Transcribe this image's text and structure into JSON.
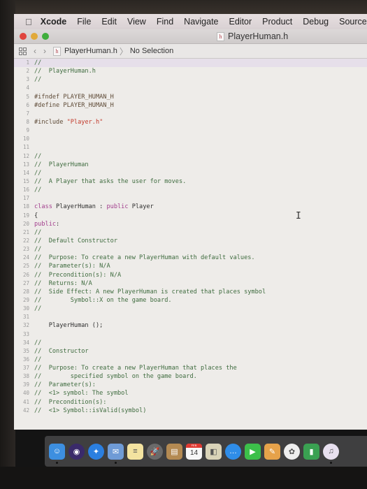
{
  "menubar": {
    "apple_icon": "apple-icon",
    "items": [
      "Xcode",
      "File",
      "Edit",
      "View",
      "Find",
      "Navigate",
      "Editor",
      "Product",
      "Debug",
      "Source"
    ]
  },
  "window": {
    "title": "PlayerHuman.h",
    "file_type_glyph": "h"
  },
  "jumpbar": {
    "file": "PlayerHuman.h",
    "selection": "No Selection",
    "back_glyph": "‹",
    "forward_glyph": "›",
    "separator": "〉"
  },
  "editor": {
    "current_line": 1,
    "lines": [
      {
        "n": "1",
        "segs": [
          {
            "t": "//",
            "c": "cm"
          }
        ]
      },
      {
        "n": "2",
        "segs": [
          {
            "t": "//  PlayerHuman.h",
            "c": "cm"
          }
        ]
      },
      {
        "n": "3",
        "segs": [
          {
            "t": "//",
            "c": "cm"
          }
        ]
      },
      {
        "n": "4",
        "segs": []
      },
      {
        "n": "5",
        "segs": [
          {
            "t": "#ifndef PLAYER_HUMAN_H",
            "c": "pp"
          }
        ]
      },
      {
        "n": "6",
        "segs": [
          {
            "t": "#define PLAYER_HUMAN_H",
            "c": "pp"
          }
        ]
      },
      {
        "n": "7",
        "segs": []
      },
      {
        "n": "8",
        "segs": [
          {
            "t": "#include ",
            "c": "pp"
          },
          {
            "t": "\"Player.h\"",
            "c": "str"
          }
        ]
      },
      {
        "n": "9",
        "segs": []
      },
      {
        "n": "10",
        "segs": []
      },
      {
        "n": "11",
        "segs": []
      },
      {
        "n": "12",
        "segs": [
          {
            "t": "//",
            "c": "cm"
          }
        ]
      },
      {
        "n": "13",
        "segs": [
          {
            "t": "//  PlayerHuman",
            "c": "cm"
          }
        ]
      },
      {
        "n": "14",
        "segs": [
          {
            "t": "//",
            "c": "cm"
          }
        ]
      },
      {
        "n": "15",
        "segs": [
          {
            "t": "//  A Player that asks the user for moves.",
            "c": "cm"
          }
        ]
      },
      {
        "n": "16",
        "segs": [
          {
            "t": "//",
            "c": "cm"
          }
        ]
      },
      {
        "n": "17",
        "segs": []
      },
      {
        "n": "18",
        "segs": [
          {
            "t": "class",
            "c": "kw"
          },
          {
            "t": " PlayerHuman : ",
            "c": ""
          },
          {
            "t": "public",
            "c": "kw"
          },
          {
            "t": " Player",
            "c": ""
          }
        ]
      },
      {
        "n": "19",
        "segs": [
          {
            "t": "{",
            "c": ""
          }
        ]
      },
      {
        "n": "20",
        "segs": [
          {
            "t": "public",
            "c": "kw"
          },
          {
            "t": ":",
            "c": ""
          }
        ]
      },
      {
        "n": "21",
        "segs": [
          {
            "t": "//",
            "c": "cm"
          }
        ]
      },
      {
        "n": "22",
        "segs": [
          {
            "t": "//  Default Constructor",
            "c": "cm"
          }
        ]
      },
      {
        "n": "23",
        "segs": [
          {
            "t": "//",
            "c": "cm"
          }
        ]
      },
      {
        "n": "24",
        "segs": [
          {
            "t": "//  Purpose: To create a new PlayerHuman with default values.",
            "c": "cm"
          }
        ]
      },
      {
        "n": "25",
        "segs": [
          {
            "t": "//  Parameter(s): N/A",
            "c": "cm"
          }
        ]
      },
      {
        "n": "26",
        "segs": [
          {
            "t": "//  Precondition(s): N/A",
            "c": "cm"
          }
        ]
      },
      {
        "n": "27",
        "segs": [
          {
            "t": "//  Returns: N/A",
            "c": "cm"
          }
        ]
      },
      {
        "n": "28",
        "segs": [
          {
            "t": "//  Side Effect: A new PlayerHuman is created that places symbol",
            "c": "cm"
          }
        ]
      },
      {
        "n": "29",
        "segs": [
          {
            "t": "//        Symbol::X on the game board.",
            "c": "cm"
          }
        ]
      },
      {
        "n": "30",
        "segs": [
          {
            "t": "//",
            "c": "cm"
          }
        ]
      },
      {
        "n": "31",
        "segs": []
      },
      {
        "n": "32",
        "segs": [
          {
            "t": "    PlayerHuman ();",
            "c": ""
          }
        ]
      },
      {
        "n": "33",
        "segs": []
      },
      {
        "n": "34",
        "segs": [
          {
            "t": "//",
            "c": "cm"
          }
        ]
      },
      {
        "n": "35",
        "segs": [
          {
            "t": "//  Constructor",
            "c": "cm"
          }
        ]
      },
      {
        "n": "36",
        "segs": [
          {
            "t": "//",
            "c": "cm"
          }
        ]
      },
      {
        "n": "37",
        "segs": [
          {
            "t": "//  Purpose: To create a new PlayerHuman that places the",
            "c": "cm"
          }
        ]
      },
      {
        "n": "38",
        "segs": [
          {
            "t": "//        specified symbol on the game board.",
            "c": "cm"
          }
        ]
      },
      {
        "n": "39",
        "segs": [
          {
            "t": "//  Parameter(s):",
            "c": "cm"
          }
        ]
      },
      {
        "n": "40",
        "segs": [
          {
            "t": "//  <1> symbol: The symbol",
            "c": "cm"
          }
        ]
      },
      {
        "n": "41",
        "segs": [
          {
            "t": "//  Precondition(s):",
            "c": "cm"
          }
        ]
      },
      {
        "n": "42",
        "segs": [
          {
            "t": "//  <1> Symbol::isValid(symbol)",
            "c": "cm"
          }
        ]
      }
    ]
  },
  "cursor": {
    "glyph": "I"
  },
  "dock": {
    "apps": [
      {
        "name": "finder",
        "glyph": "☺",
        "bg": "#3d8fe0",
        "running": true
      },
      {
        "name": "siri",
        "glyph": "◉",
        "bg": "#3a2a6a",
        "round": true
      },
      {
        "name": "safari",
        "glyph": "✦",
        "bg": "#2b7fe0",
        "round": true
      },
      {
        "name": "mail",
        "glyph": "✉",
        "bg": "#6f9bd6",
        "running": true
      },
      {
        "name": "notes",
        "glyph": "≡",
        "bg": "#f3e3a0"
      },
      {
        "name": "launchpad",
        "glyph": "🚀",
        "bg": "#6a6a6a",
        "round": true
      },
      {
        "name": "contacts",
        "glyph": "▤",
        "bg": "#b48a52"
      },
      {
        "name": "calendar",
        "glyph": "14",
        "month": "FEB",
        "bg": "#f7f7f7"
      },
      {
        "name": "preview",
        "glyph": "◧",
        "bg": "#d9d3b8"
      },
      {
        "name": "messages",
        "glyph": "…",
        "bg": "#2f8de8",
        "round": true
      },
      {
        "name": "facetime",
        "glyph": "▶",
        "bg": "#3cbf4a"
      },
      {
        "name": "pages",
        "glyph": "✎",
        "bg": "#e6a24a"
      },
      {
        "name": "photos",
        "glyph": "✿",
        "bg": "#eeeeee",
        "round": true
      },
      {
        "name": "numbers",
        "glyph": "▮",
        "bg": "#3aa152"
      },
      {
        "name": "itunes",
        "glyph": "♫",
        "bg": "#e8e0ef",
        "round": true,
        "running": true
      }
    ]
  }
}
